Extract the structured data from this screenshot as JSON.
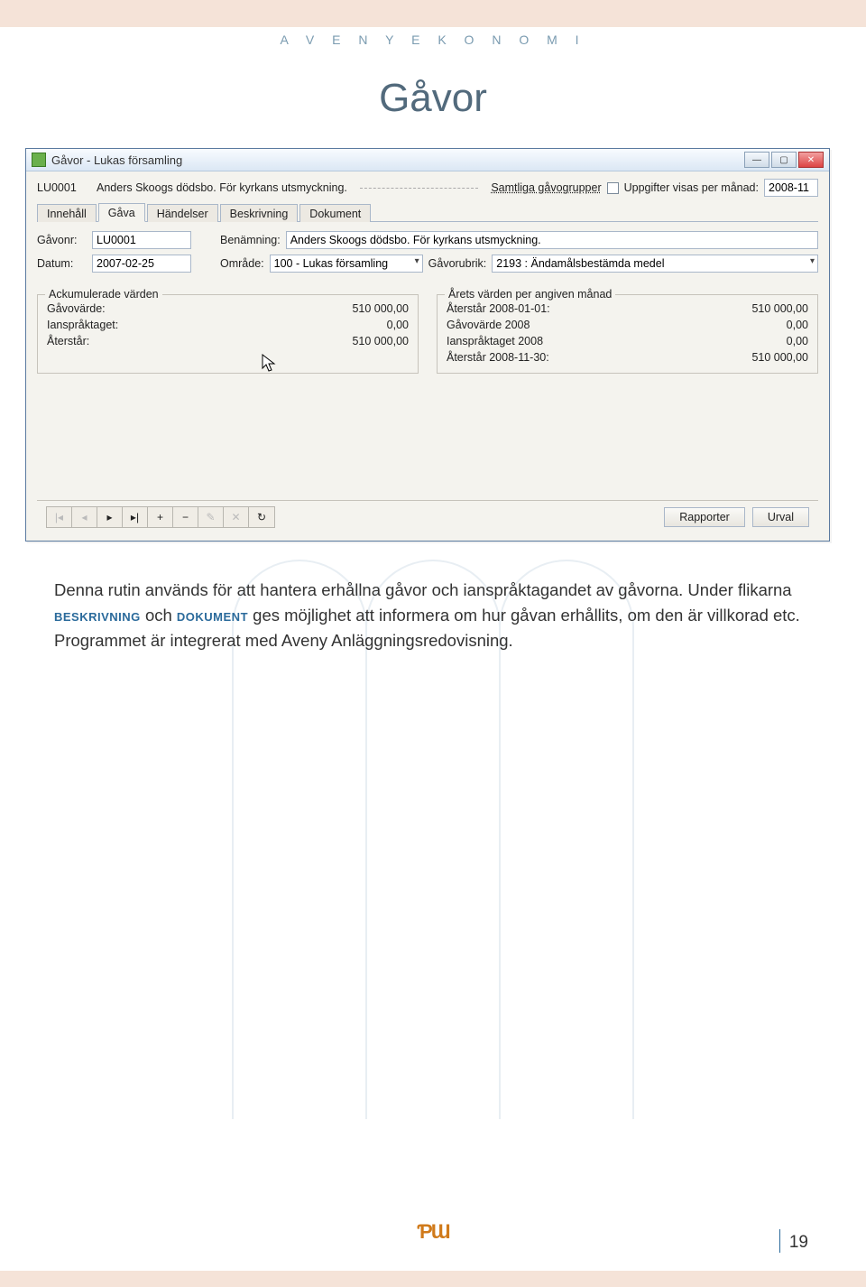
{
  "page": {
    "header": "A V E N Y   E K O N O M I",
    "sectionTitle": "Gåvor",
    "pageNumber": "19",
    "footerLogo": "ƤƜ"
  },
  "window": {
    "title": "Gåvor - Lukas församling",
    "min": "—",
    "max": "▢",
    "close": "✕"
  },
  "topRow": {
    "code": "LU0001",
    "desc": "Anders Skoogs dödsbo. För kyrkans utsmyckning.",
    "groupLabel": "Samtliga gåvogrupper",
    "uppgifterLabel": "Uppgifter visas per månad:",
    "uppgifterValue": "2008-11"
  },
  "tabs": {
    "innehall": "Innehåll",
    "gava": "Gåva",
    "handelser": "Händelser",
    "beskrivning": "Beskrivning",
    "dokument": "Dokument"
  },
  "fields": {
    "gavonrLabel": "Gåvonr:",
    "gavonrValue": "LU0001",
    "benamningLabel": "Benämning:",
    "benamningValue": "Anders Skoogs dödsbo. För kyrkans utsmyckning.",
    "datumLabel": "Datum:",
    "datumValue": "2007-02-25",
    "omradeLabel": "Område:",
    "omradeValue": "100 - Lukas församling",
    "gavorubrikLabel": "Gåvorubrik:",
    "gavorubrikValue": "2193 : Ändamålsbestämda medel"
  },
  "ack": {
    "title": "Ackumulerade värden",
    "rows": [
      {
        "label": "Gåvovärde:",
        "value": "510 000,00"
      },
      {
        "label": "Ianspråktaget:",
        "value": "0,00"
      },
      {
        "label": "Återstår:",
        "value": "510 000,00"
      }
    ]
  },
  "year": {
    "title": "Årets värden per angiven månad",
    "rows": [
      {
        "label": "Återstår 2008-01-01:",
        "value": "510 000,00"
      },
      {
        "label": "Gåvovärde 2008",
        "value": "0,00"
      },
      {
        "label": "Ianspråktaget 2008",
        "value": "0,00"
      },
      {
        "label": "Återstår 2008-11-30:",
        "value": "510 000,00"
      }
    ]
  },
  "nav": {
    "first": "|◂",
    "prev": "◂",
    "next": "▸",
    "last": "▸|",
    "plus": "+",
    "minus": "−",
    "edit": "✎",
    "cancel": "✕",
    "refresh": "↻"
  },
  "buttons": {
    "rapporter": "Rapporter",
    "urval": "Urval"
  },
  "bodyText": {
    "p1a": "Denna rutin används för att hantera erhållna gåvor och ianspråktagandet av gåvorna. Under flikarna ",
    "kw1": "beskrivning",
    "p1b": " och ",
    "kw2": "dokument",
    "p1c": " ges möjlighet att informera om hur gåvan erhållits, om den är villkorad etc.",
    "p2": "Programmet är integrerat med Aveny Anläggningsredovisning."
  }
}
